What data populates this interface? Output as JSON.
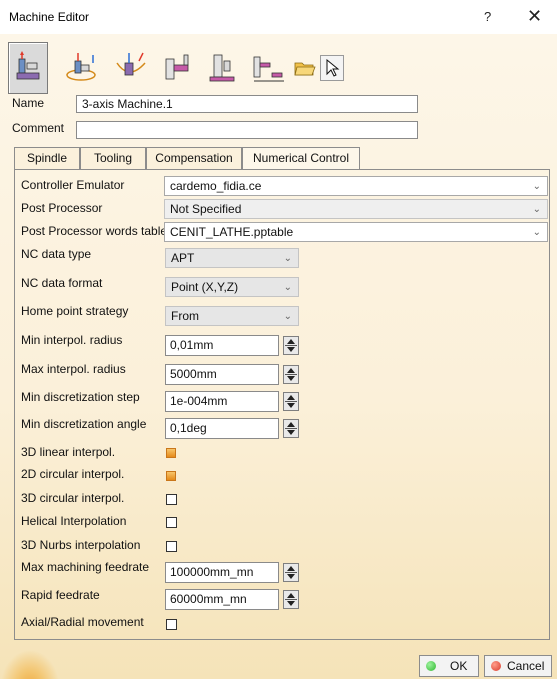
{
  "window": {
    "title": "Machine Editor",
    "help_label": "?",
    "close_label": "✕"
  },
  "toolbar": {
    "icons": [
      "3-axis-machine-icon",
      "3-axis-rotary-table-machine-icon",
      "5-axis-machine-icon",
      "horizontal-lathe-icon",
      "vertical-lathe-icon",
      "multi-slide-lathe-icon",
      "open-folder-icon",
      "select-cursor-icon"
    ]
  },
  "name": {
    "label": "Name",
    "value": "3-axis Machine.1"
  },
  "comment": {
    "label": "Comment",
    "value": ""
  },
  "tabs": [
    {
      "label": "Spindle"
    },
    {
      "label": "Tooling"
    },
    {
      "label": "Compensation"
    },
    {
      "label": "Numerical Control",
      "active": true
    }
  ],
  "nc": {
    "controller_emulator": {
      "label": "Controller Emulator",
      "value": "cardemo_fidia.ce"
    },
    "post_processor": {
      "label": "Post Processor",
      "value": "Not Specified"
    },
    "pp_words_table": {
      "label": "Post Processor words table",
      "value": "CENIT_LATHE.pptable"
    },
    "nc_data_type": {
      "label": "NC data type",
      "value": "APT"
    },
    "nc_data_format": {
      "label": "NC data format",
      "value": "Point (X,Y,Z)"
    },
    "home_point_strategy": {
      "label": "Home point strategy",
      "value": "From"
    },
    "min_interp_radius": {
      "label": "Min interpol. radius",
      "value": "0,01mm"
    },
    "max_interp_radius": {
      "label": "Max interpol. radius",
      "value": "5000mm"
    },
    "min_disc_step": {
      "label": "Min discretization step",
      "value": "1e-004mm"
    },
    "min_disc_angle": {
      "label": "Min discretization angle",
      "value": "0,1deg"
    },
    "linear_3d": {
      "label": "3D linear interpol.",
      "checked": true
    },
    "circular_2d": {
      "label": "2D circular interpol.",
      "checked": true
    },
    "circular_3d": {
      "label": "3D circular interpol.",
      "checked": false
    },
    "helical": {
      "label": "Helical Interpolation",
      "checked": false
    },
    "nurbs_3d": {
      "label": "3D Nurbs interpolation",
      "checked": false
    },
    "max_feedrate": {
      "label": "Max machining feedrate",
      "value": "100000mm_mn"
    },
    "rapid_feedrate": {
      "label": "Rapid feedrate",
      "value": "60000mm_mn"
    },
    "axial_radial": {
      "label": "Axial/Radial movement",
      "checked": false
    }
  },
  "footer": {
    "ok_label": "OK",
    "cancel_label": "Cancel"
  },
  "colors": {
    "ok_dot": "#2fb82f",
    "cancel_dot": "#d93a2b",
    "checked_fill": "#f0a63a"
  }
}
